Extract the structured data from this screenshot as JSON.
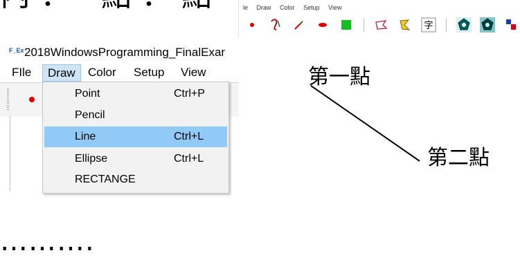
{
  "background_text": "內   ：一點  ： 點      一 點 ：  點  可 點",
  "toolbar": {
    "mini_menu": [
      "le",
      "Draw",
      "Color",
      "Setup",
      "View"
    ],
    "char_tool_label": "字",
    "tools": [
      {
        "name": "point-tool-icon"
      },
      {
        "name": "pencil-tool-icon"
      },
      {
        "name": "line-tool-icon"
      },
      {
        "name": "ellipse-tool-icon"
      },
      {
        "name": "rectangle-tool-icon"
      },
      {
        "name": "freeform-tool-icon"
      },
      {
        "name": "polygon-tool-icon"
      },
      {
        "name": "text-tool-icon"
      },
      {
        "name": "fill-tool-icon"
      },
      {
        "name": "pattern-fill-tool-icon"
      },
      {
        "name": "eraser-tool-icon"
      },
      {
        "name": "arrow-tool-icon"
      }
    ]
  },
  "window": {
    "app_icon_text": "F_Ex",
    "title": "2018WindowsProgramming_FinalExar",
    "menus": [
      {
        "label": "FIle",
        "active": false
      },
      {
        "label": "Draw",
        "active": true
      },
      {
        "label": "Color",
        "active": false
      },
      {
        "label": "Setup",
        "active": false
      },
      {
        "label": "View",
        "active": false
      }
    ]
  },
  "dropdown": {
    "items": [
      {
        "label": "Point",
        "shortcut": "Ctrl+P",
        "highlighted": false
      },
      {
        "label": "Pencil",
        "shortcut": "",
        "highlighted": false
      },
      {
        "label": "Line",
        "shortcut": "Ctrl+L",
        "highlighted": true
      },
      {
        "label": "Ellipse",
        "shortcut": "Ctrl+L",
        "highlighted": false
      },
      {
        "label": "RECTANGE",
        "shortcut": "",
        "highlighted": false
      }
    ]
  },
  "annotation": {
    "first_point": "第一點",
    "second_point": "第二點"
  },
  "footer_dots": "……….",
  "colors": {
    "highlight": "#91c9f7",
    "menu_active": "#cfe5f7",
    "point_red": "#e00000"
  }
}
